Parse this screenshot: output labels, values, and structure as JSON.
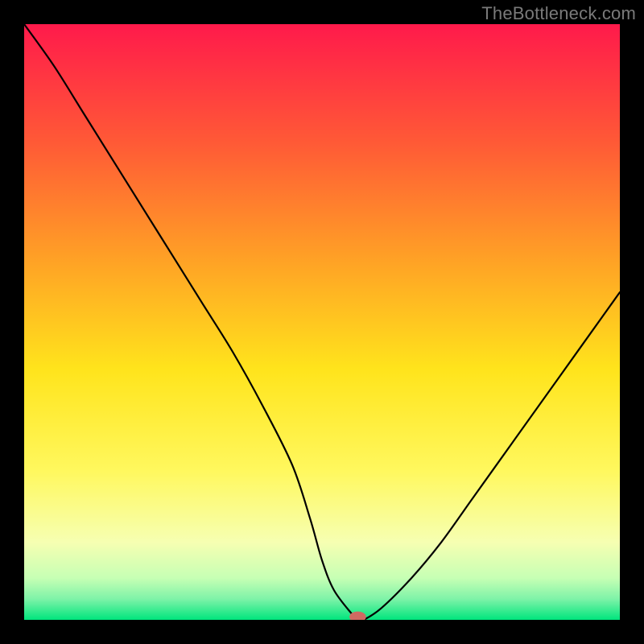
{
  "attribution": "TheBottleneck.com",
  "chart_data": {
    "type": "line",
    "title": "",
    "xlabel": "",
    "ylabel": "",
    "xlim": [
      0,
      100
    ],
    "ylim": [
      0,
      100
    ],
    "grid": false,
    "legend": false,
    "background_gradient_stops": [
      {
        "offset": 0.0,
        "color": "#ff1a4b"
      },
      {
        "offset": 0.2,
        "color": "#ff5a36"
      },
      {
        "offset": 0.4,
        "color": "#ffa325"
      },
      {
        "offset": 0.58,
        "color": "#ffe41c"
      },
      {
        "offset": 0.75,
        "color": "#fff85e"
      },
      {
        "offset": 0.87,
        "color": "#f6ffb2"
      },
      {
        "offset": 0.93,
        "color": "#c6ffb4"
      },
      {
        "offset": 0.965,
        "color": "#7ef3a8"
      },
      {
        "offset": 1.0,
        "color": "#00e57d"
      }
    ],
    "series": [
      {
        "name": "bottleneck-curve",
        "stroke": "#000000",
        "stroke_width": 2.2,
        "x": [
          0,
          5,
          10,
          15,
          20,
          25,
          30,
          35,
          40,
          45,
          48,
          50,
          52,
          55,
          56,
          57,
          60,
          65,
          70,
          75,
          80,
          85,
          90,
          95,
          100
        ],
        "y": [
          100,
          93,
          85,
          77,
          69,
          61,
          53,
          45,
          36,
          26,
          17,
          10,
          5,
          1,
          0,
          0,
          2,
          7,
          13,
          20,
          27,
          34,
          41,
          48,
          55
        ]
      }
    ],
    "marker": {
      "name": "optimal-point",
      "x": 56,
      "y": 0.5,
      "rx": 1.4,
      "ry": 0.9,
      "fill": "#cf6a62"
    }
  }
}
